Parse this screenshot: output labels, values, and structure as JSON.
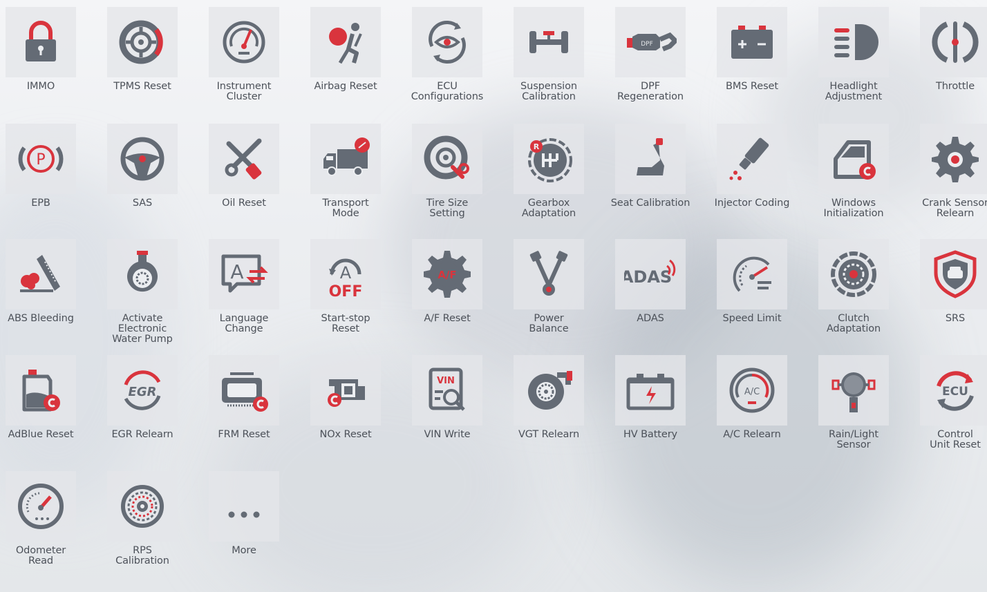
{
  "colors": {
    "gray": "#646b75",
    "red": "#d9343d",
    "text": "#4c5159",
    "tile_bg": "#e4e6e9"
  },
  "tiles": [
    {
      "label": "IMMO",
      "icon": "padlock-icon"
    },
    {
      "label": "TPMS Reset",
      "icon": "tire-pressure-icon"
    },
    {
      "label": "Instrument\nCluster",
      "icon": "gauge-icon"
    },
    {
      "label": "Airbag Reset",
      "icon": "airbag-icon"
    },
    {
      "label": "ECU\nConfigurations",
      "icon": "ecu-config-icon"
    },
    {
      "label": "Suspension\nCalibration",
      "icon": "suspension-icon"
    },
    {
      "label": "DPF\nRegeneration",
      "icon": "dpf-icon",
      "icon_text": "DPF"
    },
    {
      "label": "BMS Reset",
      "icon": "battery-icon"
    },
    {
      "label": "Headlight\nAdjustment",
      "icon": "headlight-icon"
    },
    {
      "label": "Throttle",
      "icon": "throttle-icon"
    },
    {
      "label": "EPB",
      "icon": "parking-brake-icon",
      "icon_text": "P"
    },
    {
      "label": "SAS",
      "icon": "steering-wheel-icon"
    },
    {
      "label": "Oil Reset",
      "icon": "wrench-oil-icon"
    },
    {
      "label": "Transport\nMode",
      "icon": "truck-icon"
    },
    {
      "label": "Tire Size\nSetting",
      "icon": "tire-wrench-icon"
    },
    {
      "label": "Gearbox\nAdaptation",
      "icon": "gearbox-icon",
      "icon_text": "R"
    },
    {
      "label": "Seat Calibration",
      "icon": "seat-icon"
    },
    {
      "label": "Injector Coding",
      "icon": "injector-icon"
    },
    {
      "label": "Windows\nInitialization",
      "icon": "car-door-icon"
    },
    {
      "label": "Crank Sensor\nRelearn",
      "icon": "gear-icon"
    },
    {
      "label": "ABS Bleeding",
      "icon": "abs-bleed-icon"
    },
    {
      "label": "Activate\nElectronic\nWater Pump",
      "icon": "water-pump-icon"
    },
    {
      "label": "Language\nChange",
      "icon": "language-icon",
      "icon_text": "A"
    },
    {
      "label": "Start-stop\nReset",
      "icon": "start-stop-icon",
      "icon_text": "A",
      "icon_text2": "OFF"
    },
    {
      "label": "A/F Reset",
      "icon": "af-gear-icon",
      "icon_text": "A/F"
    },
    {
      "label": "Power\nBalance",
      "icon": "power-balance-icon"
    },
    {
      "label": "ADAS",
      "icon": "adas-icon",
      "icon_text": "ADAS"
    },
    {
      "label": "Speed Limit",
      "icon": "speedometer-icon"
    },
    {
      "label": "Clutch\nAdaptation",
      "icon": "clutch-icon"
    },
    {
      "label": "SRS",
      "icon": "shield-car-icon"
    },
    {
      "label": "AdBlue Reset",
      "icon": "adblue-icon"
    },
    {
      "label": "EGR Relearn",
      "icon": "egr-icon",
      "icon_text": "EGR"
    },
    {
      "label": "FRM Reset",
      "icon": "frm-module-icon"
    },
    {
      "label": "NOx Reset",
      "icon": "nox-sensor-icon"
    },
    {
      "label": "VIN Write",
      "icon": "vin-search-icon",
      "icon_text": "VIN"
    },
    {
      "label": "VGT Relearn",
      "icon": "turbo-icon"
    },
    {
      "label": "HV Battery",
      "icon": "hv-battery-icon"
    },
    {
      "label": "A/C Relearn",
      "icon": "ac-gauge-icon",
      "icon_text": "A/C"
    },
    {
      "label": "Rain/Light\nSensor",
      "icon": "rain-light-sensor-icon"
    },
    {
      "label": "Control\nUnit Reset",
      "icon": "ecu-reset-icon",
      "icon_text": "ECU"
    },
    {
      "label": "Odometer\nRead",
      "icon": "odometer-icon"
    },
    {
      "label": "RPS\nCalibration",
      "icon": "rps-icon"
    },
    {
      "label": "More",
      "icon": "more-dots-icon"
    }
  ]
}
